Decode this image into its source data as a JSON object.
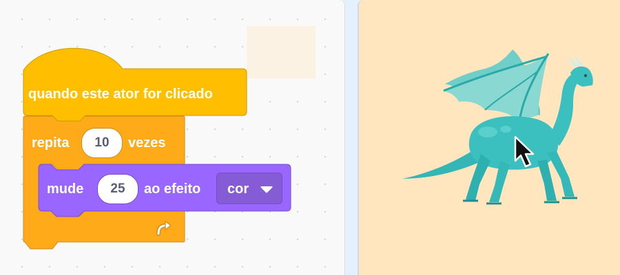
{
  "code_area": {
    "hat_block": {
      "label": "quando este ator for clicado"
    },
    "repeat_block": {
      "label_before": "repita",
      "times": "10",
      "label_after": "vezes"
    },
    "effect_block": {
      "label_before": "mude",
      "amount": "25",
      "label_after": "ao efeito",
      "effect_selected": "cor"
    }
  },
  "stage": {
    "sprite": "dragon"
  },
  "icons": {
    "loop": "loop-arrow-icon",
    "dropdown": "dropdown-triangle-icon",
    "cursor": "mouse-pointer-icon"
  },
  "colors": {
    "events": "#ffbf00",
    "control": "#ffab19",
    "looks": "#9966ff",
    "stage_bg": "#ffe6bf",
    "dragon": "#3bbfbf"
  }
}
